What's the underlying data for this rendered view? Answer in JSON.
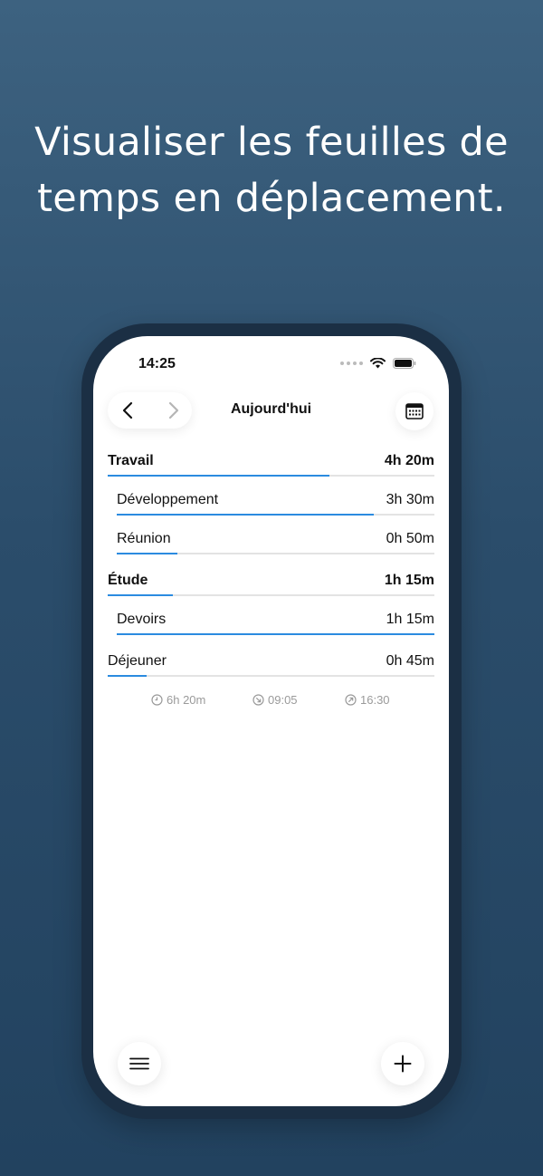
{
  "headline": {
    "line1": "Visualiser les feuilles de",
    "line2": "temps en déplacement."
  },
  "status_bar": {
    "time": "14:25"
  },
  "header": {
    "title": "Aujourd'hui"
  },
  "entries": [
    {
      "label": "Travail",
      "value": "4h 20m",
      "level": "group",
      "fraction": 0.68
    },
    {
      "label": "Développement",
      "value": "3h 30m",
      "level": "sub",
      "fraction": 0.81
    },
    {
      "label": "Réunion",
      "value": "0h 50m",
      "level": "sub",
      "fraction": 0.19
    },
    {
      "label": "Étude",
      "value": "1h 15m",
      "level": "group",
      "fraction": 0.2
    },
    {
      "label": "Devoirs",
      "value": "1h 15m",
      "level": "sub",
      "fraction": 1.0
    },
    {
      "label": "Déjeuner",
      "value": "0h 45m",
      "level": "single",
      "fraction": 0.12
    }
  ],
  "summary": {
    "total": "6h 20m",
    "start": "09:05",
    "end": "16:30"
  },
  "colors": {
    "accent": "#2b8be0",
    "track": "#e3e3e3",
    "background_top": "#3d6280",
    "background_bottom": "#22425f",
    "phone_frame": "#1b2f44"
  },
  "icons": {
    "prev": "chevron-left-icon",
    "next": "chevron-right-icon",
    "calendar": "calendar-icon",
    "menu": "menu-icon",
    "add": "plus-icon",
    "total": "clock-icon",
    "start": "clock-in-icon",
    "end": "clock-out-icon"
  }
}
